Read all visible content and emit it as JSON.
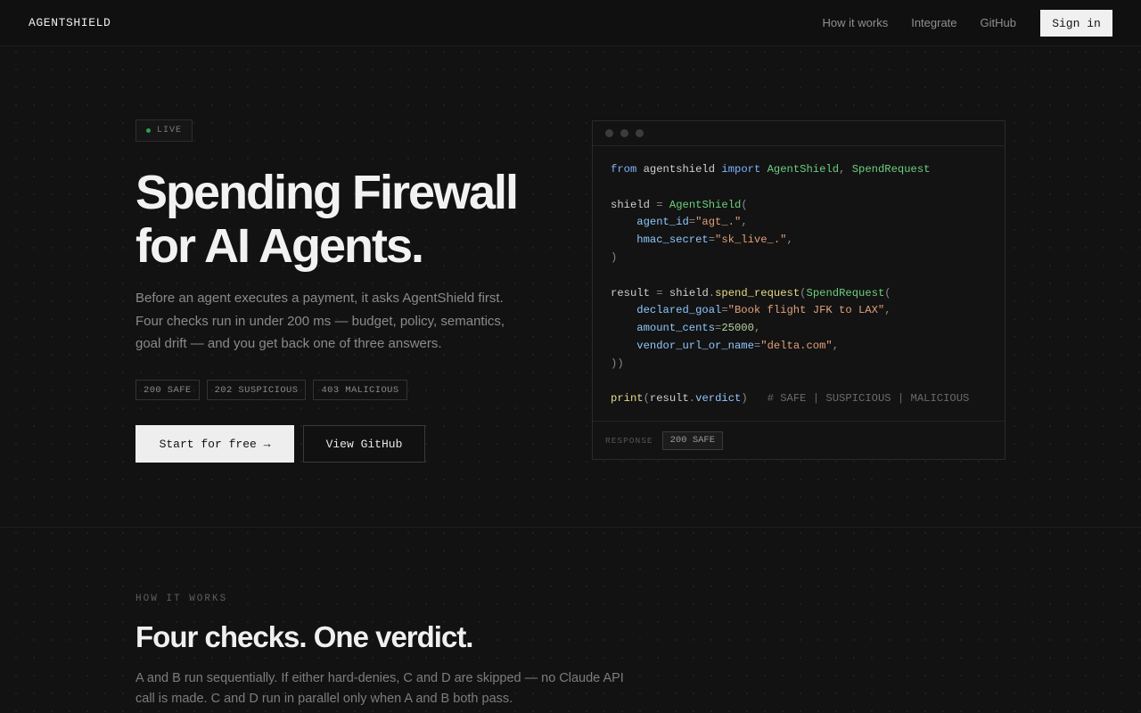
{
  "nav": {
    "brand": "AGENTSHIELD",
    "links": [
      "How it works",
      "Integrate",
      "GitHub"
    ],
    "signin": "Sign in"
  },
  "hero": {
    "badge": "LIVE",
    "title_line1": "Spending Firewall",
    "title_line2": "for AI Agents.",
    "description": "Before an agent executes a payment, it asks AgentShield first. Four checks run in under 200 ms — budget, policy, semantics, goal drift — and you get back one of three answers.",
    "answers": [
      "200 SAFE",
      "202 SUSPICIOUS",
      "403 MALICIOUS"
    ],
    "primary_cta": "Start for free →",
    "secondary_cta": "View GitHub"
  },
  "code": {
    "l1_from": "from",
    "l1_mod": "agentshield",
    "l1_import": "import",
    "l1_c1": "AgentShield",
    "l1_c2": "SpendRequest",
    "l3_var": "shield",
    "l3_cls": "AgentShield",
    "l4_param": "agent_id",
    "l4_val": "\"agt_.\"",
    "l5_param": "hmac_secret",
    "l5_val": "\"sk_live_.\"",
    "l8_var": "result",
    "l8_obj": "shield",
    "l8_fn": "spend_request",
    "l8_cls": "SpendRequest",
    "l9_param": "declared_goal",
    "l9_val": "\"Book flight JFK to LAX\"",
    "l10_param": "amount_cents",
    "l10_val": "25000",
    "l11_param": "vendor_url_or_name",
    "l11_val": "\"delta.com\"",
    "l14_fn": "print",
    "l14_arg": "result",
    "l14_attr": "verdict",
    "l14_comment": "# SAFE | SUSPICIOUS | MALICIOUS"
  },
  "response": {
    "label": "RESPONSE",
    "value": "200 SAFE"
  },
  "how": {
    "eyebrow": "HOW IT WORKS",
    "title": "Four checks. One verdict.",
    "description": "A and B run sequentially. If either hard-denies, C and D are skipped — no Claude API call is made. C and D run in parallel only when A and B both pass."
  }
}
